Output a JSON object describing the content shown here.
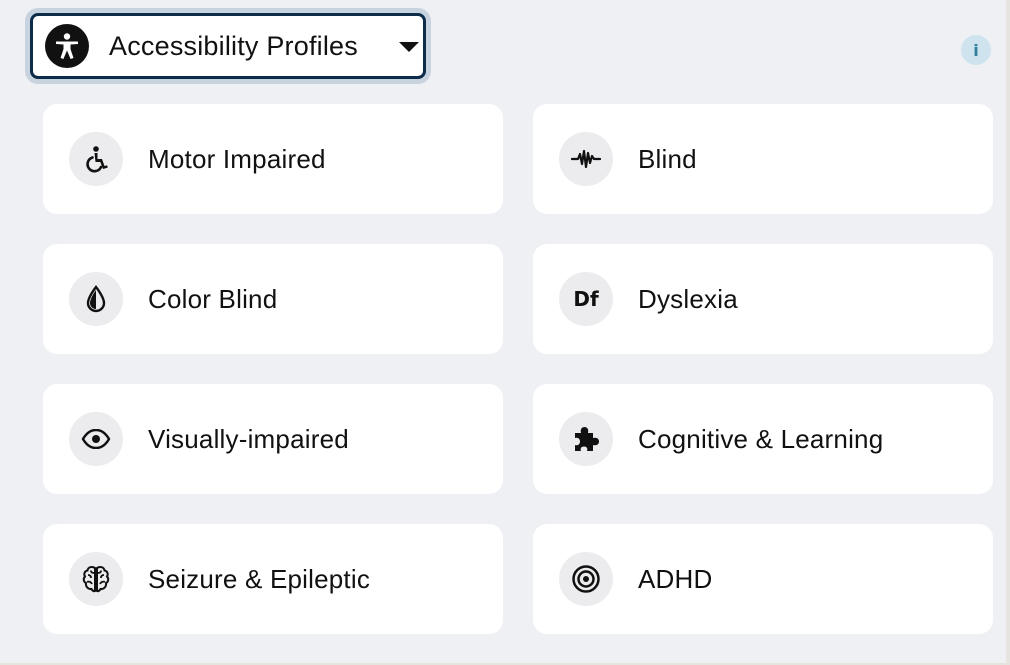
{
  "header": {
    "dropdown_label": "Accessibility Profiles",
    "info_label": "i"
  },
  "profiles": [
    {
      "label": "Motor Impaired",
      "icon": "wheelchair-icon"
    },
    {
      "label": "Blind",
      "icon": "audio-wave-icon"
    },
    {
      "label": "Color Blind",
      "icon": "droplet-icon"
    },
    {
      "label": "Dyslexia",
      "icon": "df-font-icon",
      "icon_text": "Df"
    },
    {
      "label": "Visually-impaired",
      "icon": "eye-icon"
    },
    {
      "label": "Cognitive & Learning",
      "icon": "puzzle-icon"
    },
    {
      "label": "Seizure & Epileptic",
      "icon": "brain-icon"
    },
    {
      "label": "ADHD",
      "icon": "target-icon"
    }
  ],
  "colors": {
    "background": "#eef0f4",
    "card": "#ffffff",
    "icon_circle": "#ececee",
    "dropdown_border": "#0c2c4a",
    "info_bg": "#cfe3ee",
    "info_fg": "#2f7f9c"
  }
}
